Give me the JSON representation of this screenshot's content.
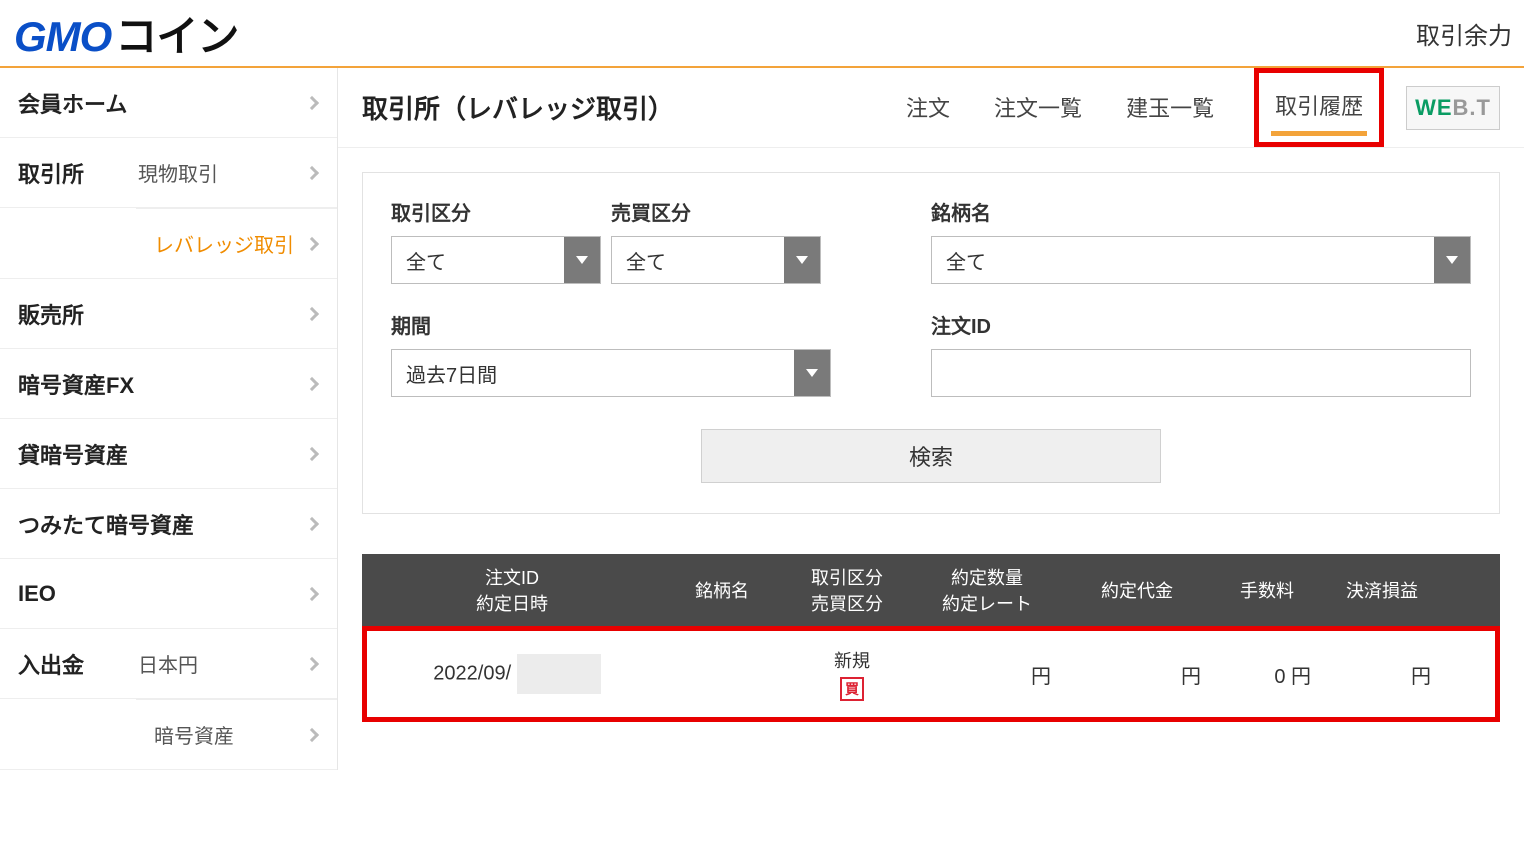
{
  "header": {
    "logo_primary": "GMO",
    "logo_secondary": "コイン",
    "balance_label": "取引余力"
  },
  "sidebar": {
    "home": "会員ホーム",
    "exchange": "取引所",
    "exchange_spot": "現物取引",
    "exchange_leverage": "レバレッジ取引",
    "sales": "販売所",
    "crypto_fx": "暗号資産FX",
    "lending": "貸暗号資産",
    "tsumitate": "つみたて暗号資産",
    "ieo": "IEO",
    "inout": "入出金",
    "inout_jpy": "日本円",
    "inout_crypto": "暗号資産"
  },
  "main": {
    "title": "取引所（レバレッジ取引）",
    "tabs": {
      "order": "注文",
      "order_list": "注文一覧",
      "position_list": "建玉一覧",
      "trade_history": "取引履歴"
    },
    "web_badge_a": "WE",
    "web_badge_b": "B.T"
  },
  "filters": {
    "trade_type_label": "取引区分",
    "trade_type_value": "全て",
    "side_label": "売買区分",
    "side_value": "全て",
    "symbol_label": "銘柄名",
    "symbol_value": "全て",
    "period_label": "期間",
    "period_value": "過去7日間",
    "order_id_label": "注文ID",
    "order_id_value": "",
    "search_label": "検索"
  },
  "table": {
    "headers": {
      "id_line1": "注文ID",
      "id_line2": "約定日時",
      "symbol": "銘柄名",
      "type_line1": "取引区分",
      "type_line2": "売買区分",
      "qty_line1": "約定数量",
      "qty_line2": "約定レート",
      "amount": "約定代金",
      "fee": "手数料",
      "pnl": "決済損益"
    },
    "row": {
      "date_prefix": "2022/09/",
      "type_label": "新規",
      "side_badge": "買",
      "qty_unit": "円",
      "amount_unit": "円",
      "fee": "0 円",
      "pnl_unit": "円"
    }
  }
}
